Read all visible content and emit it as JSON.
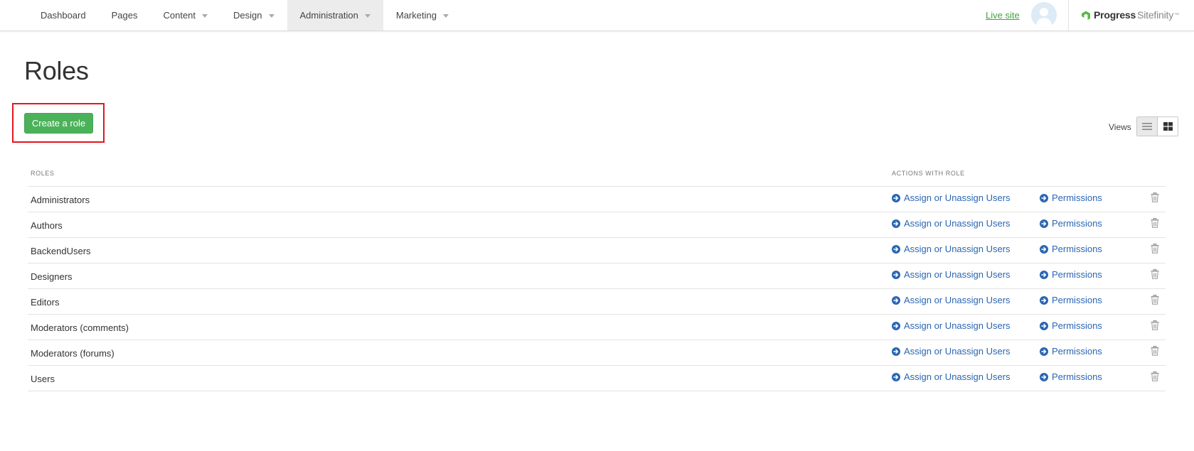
{
  "nav": {
    "items": [
      {
        "label": "Dashboard",
        "dropdown": false,
        "active": false
      },
      {
        "label": "Pages",
        "dropdown": false,
        "active": false
      },
      {
        "label": "Content",
        "dropdown": true,
        "active": false
      },
      {
        "label": "Design",
        "dropdown": true,
        "active": false
      },
      {
        "label": "Administration",
        "dropdown": true,
        "active": true
      },
      {
        "label": "Marketing",
        "dropdown": true,
        "active": false
      }
    ],
    "live_site": "Live site",
    "avatar_icon": "user-avatar-icon",
    "logo": {
      "progress": "Progress",
      "sitefinity": "Sitefinity",
      "tm": "™"
    }
  },
  "page": {
    "title": "Roles",
    "create_button": "Create a role",
    "views_label": "Views"
  },
  "table": {
    "headers": {
      "roles": "ROLES",
      "actions": "ACTIONS WITH ROLE"
    },
    "rows": [
      {
        "name": "Administrators",
        "assign": "Assign or Unassign Users",
        "permissions": "Permissions"
      },
      {
        "name": "Authors",
        "assign": "Assign or Unassign Users",
        "permissions": "Permissions"
      },
      {
        "name": "BackendUsers",
        "assign": "Assign or Unassign Users",
        "permissions": "Permissions"
      },
      {
        "name": "Designers",
        "assign": "Assign or Unassign Users",
        "permissions": "Permissions"
      },
      {
        "name": "Editors",
        "assign": "Assign or Unassign Users",
        "permissions": "Permissions"
      },
      {
        "name": "Moderators (comments)",
        "assign": "Assign or Unassign Users",
        "permissions": "Permissions"
      },
      {
        "name": "Moderators (forums)",
        "assign": "Assign or Unassign Users",
        "permissions": "Permissions"
      },
      {
        "name": "Users",
        "assign": "Assign or Unassign Users",
        "permissions": "Permissions"
      }
    ]
  },
  "colors": {
    "create_button": "#4bb25a",
    "highlight_border": "#e3161e",
    "link": "#2a66b3",
    "live_site": "#3fa33f",
    "logo_accent": "#5ab946"
  }
}
